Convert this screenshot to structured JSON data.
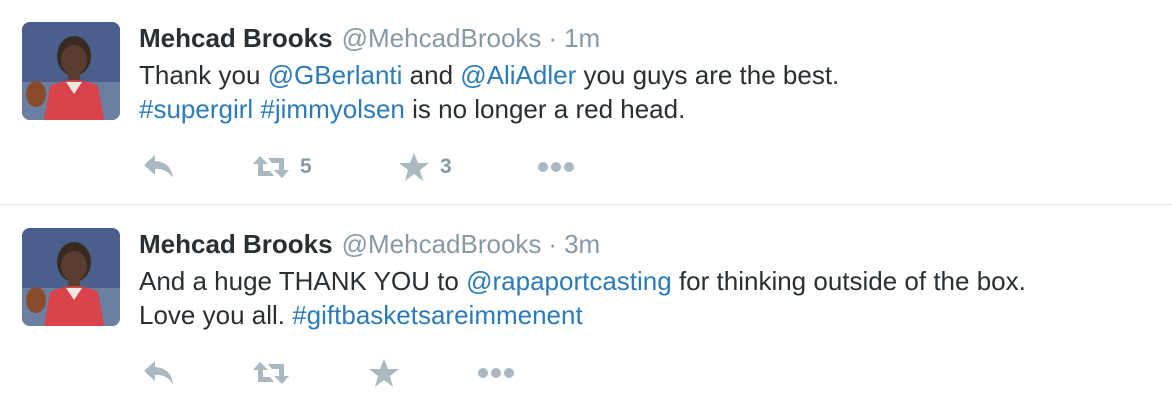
{
  "tweets": [
    {
      "name": "Mehcad Brooks",
      "handle": "@MehcadBrooks",
      "separator": "·",
      "time": "1m",
      "lines": [
        [
          {
            "text": "Thank you ",
            "link": false
          },
          {
            "text": "@GBerlanti",
            "link": true
          },
          {
            "text": " and ",
            "link": false
          },
          {
            "text": "@AliAdler",
            "link": true
          },
          {
            "text": " you guys are the best.",
            "link": false
          }
        ],
        [
          {
            "text": "#supergirl",
            "link": true
          },
          {
            "text": " ",
            "link": false
          },
          {
            "text": "#jimmyolsen",
            "link": true
          },
          {
            "text": " is no longer a red head.",
            "link": false
          }
        ]
      ],
      "retweet_count": "5",
      "favorite_count": "3"
    },
    {
      "name": "Mehcad Brooks",
      "handle": "@MehcadBrooks",
      "separator": "·",
      "time": "3m",
      "lines": [
        [
          {
            "text": "And a huge THANK YOU to ",
            "link": false
          },
          {
            "text": "@rapaportcasting",
            "link": true
          },
          {
            "text": " for thinking outside of the box.",
            "link": false
          }
        ],
        [
          {
            "text": "Love you all. ",
            "link": false
          },
          {
            "text": "#giftbasketsareimmenent",
            "link": true
          }
        ]
      ],
      "retweet_count": "",
      "favorite_count": ""
    }
  ],
  "icons": {
    "avatar": "profile-photo",
    "reply": "reply-icon",
    "retweet": "retweet-icon",
    "favorite": "star-icon",
    "more": "more-dots-icon"
  },
  "colors": {
    "name": "#292f33",
    "muted": "#8899a6",
    "link": "#2b7bb9",
    "icon": "#aab8c2",
    "divider": "#e1e8ed"
  }
}
